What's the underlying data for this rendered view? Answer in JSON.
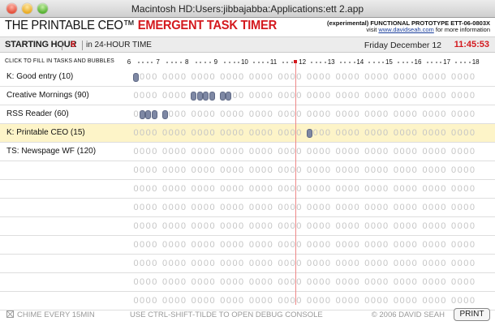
{
  "window": {
    "title": "Macintosh HD:Users:jibbajabba:Applications:ett 2.app"
  },
  "header": {
    "brand_prefix": "THE PRINTABLE CEO™",
    "brand_emphasis": "EMERGENT TASK TIMER",
    "prototype_line": "(experimental) FUNCTIONAL PROTOTYPE ETT-06-0803X",
    "visit_prefix": "visit ",
    "visit_link": "www.davidseah.com",
    "visit_suffix": " for more information"
  },
  "controls": {
    "starting_hour_label": "STARTING HOUR",
    "starting_hour_value": "6",
    "hour_note": "in 24-HOUR TIME",
    "date": "Friday December 12",
    "time": "11:45:53"
  },
  "ruler": {
    "instructions": "CLICK TO FILL IN TASKS AND BUBBLES",
    "hours": [
      "6",
      "7",
      "8",
      "9",
      "10",
      "11",
      "12",
      "13",
      "14",
      "15",
      "16",
      "17",
      "18"
    ],
    "current_time_hours": 11.76
  },
  "grid": {
    "bubble_text": "0",
    "hours_count": 12,
    "bubbles_per_hour": 4,
    "rows": [
      {
        "name": "K: Good entry (10)",
        "highlighted": false,
        "filled": [
          0
        ]
      },
      {
        "name": "Creative Mornings (90)",
        "highlighted": false,
        "filled": [
          8,
          9,
          10,
          11,
          12,
          13
        ]
      },
      {
        "name": "RSS Reader (60)",
        "highlighted": false,
        "filled": [
          1,
          2,
          3,
          4
        ]
      },
      {
        "name": "K: Printable CEO (15)",
        "highlighted": true,
        "filled": [
          24
        ]
      },
      {
        "name": "TS: Newspage WF (120)",
        "highlighted": false,
        "filled": []
      },
      {
        "name": "",
        "highlighted": false,
        "filled": []
      },
      {
        "name": "",
        "highlighted": false,
        "filled": []
      },
      {
        "name": "",
        "highlighted": false,
        "filled": []
      },
      {
        "name": "",
        "highlighted": false,
        "filled": []
      },
      {
        "name": "",
        "highlighted": false,
        "filled": []
      },
      {
        "name": "",
        "highlighted": false,
        "filled": []
      },
      {
        "name": "",
        "highlighted": false,
        "filled": []
      },
      {
        "name": "",
        "highlighted": false,
        "filled": []
      }
    ]
  },
  "footer": {
    "chime": "CHIME EVERY 15MIN",
    "debug": "USE CTRL-SHIFT-TILDE TO OPEN DEBUG CONSOLE",
    "copyright": "© 2006 DAVID SEAH",
    "print": "PRINT"
  },
  "colors": {
    "accent": "#d4191e",
    "highlight_row": "#fdf4c8",
    "filled_bubble": "#7e88a4"
  }
}
